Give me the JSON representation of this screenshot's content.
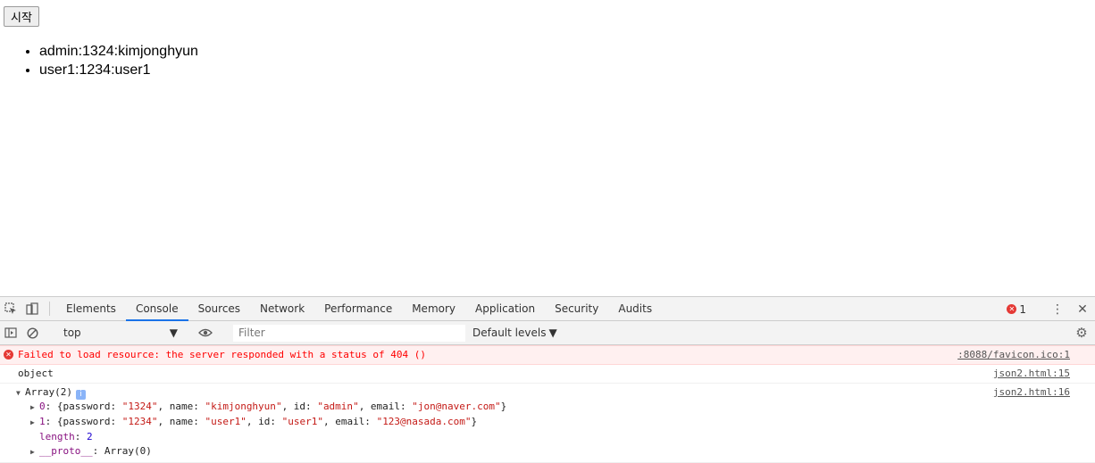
{
  "page": {
    "start_button": "시작",
    "users": [
      "admin:1324:kimjonghyun",
      "user1:1234:user1"
    ]
  },
  "devtools": {
    "tabs": [
      "Elements",
      "Console",
      "Sources",
      "Network",
      "Performance",
      "Memory",
      "Application",
      "Security",
      "Audits"
    ],
    "active_tab": "Console",
    "error_count": "1",
    "context": "top",
    "filter_placeholder": "Filter",
    "levels": "Default levels",
    "messages": {
      "error": {
        "text": "Failed to load resource: the server responded with a status of 404 ()",
        "source": ":8088/favicon.ico:1"
      },
      "object": {
        "text": "object",
        "source": "json2.html:15"
      },
      "array": {
        "label": "Array(2)",
        "source": "json2.html:16",
        "item0_key": "0",
        "item0": {
          "password": "1324",
          "name": "kimjonghyun",
          "id": "admin",
          "email": "jon@naver.com"
        },
        "item1_key": "1",
        "item1": {
          "password": "1234",
          "name": "user1",
          "id": "user1",
          "email": "123@nasada.com"
        },
        "length_key": "length",
        "length": "2",
        "proto_key": "__proto__",
        "proto": "Array(0)"
      }
    }
  },
  "colors": {
    "accent": "#1a73e8",
    "error_bg": "#fff0f0",
    "error_text": "#ff0000",
    "string": "#c41a16",
    "key": "#881280"
  }
}
